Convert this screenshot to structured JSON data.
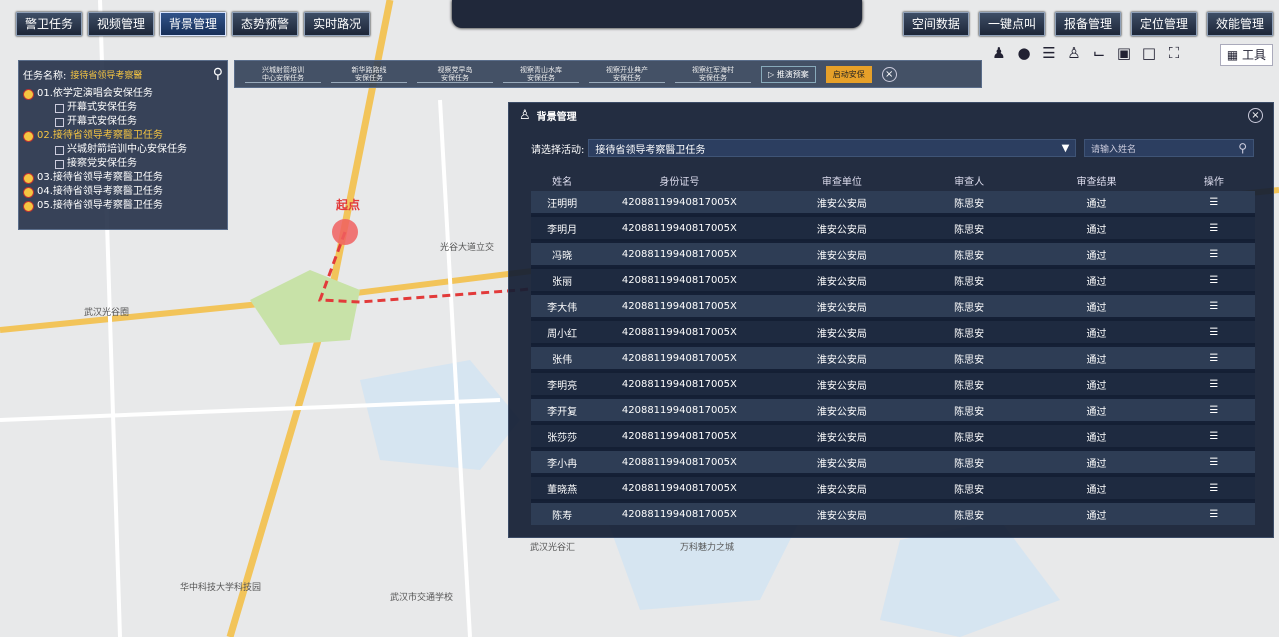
{
  "nav_left": [
    "警卫任务",
    "视频管理",
    "背景管理",
    "态势预警",
    "实时路况"
  ],
  "nav_right": [
    "空间数据",
    "一键点叫",
    "报备管理",
    "定位管理",
    "效能管理"
  ],
  "active_nav": "背景管理",
  "toolbar_label": "工具",
  "task_panel": {
    "label": "任务名称:",
    "value": "接待省领导考察醫",
    "tasks": [
      {
        "text": "01.依学定演唱会安保任务",
        "sub": [
          "开幕式安保任务",
          "开幕式安保任务"
        ]
      },
      {
        "text": "02.接待省领导考察醫卫任务",
        "selected": true,
        "sub": [
          "兴城射箭培训中心安保任务",
          "接察党安保任务"
        ]
      },
      {
        "text": "03.接待省领导考察醫卫任务",
        "sub": []
      },
      {
        "text": "04.接待省领导考察醫卫任务",
        "sub": []
      },
      {
        "text": "05.接待省领导考察醫卫任务",
        "sub": []
      }
    ]
  },
  "route_steps": [
    "兴城射箭培训\n中心安保任务",
    "新华路路线\n安保任务",
    "视察党早岛\n安保任务",
    "视察青山水库\n安保任务",
    "视察开业典产\n安保任务",
    "视察红军海村\n安保任务"
  ],
  "route_controls": {
    "preview": "推演预案",
    "start": "启动安保"
  },
  "panel": {
    "title": "背景管理",
    "filter_label": "请选择活动:",
    "filter_value": "接待省领导考察醫卫任务",
    "name_placeholder": "请输入姓名",
    "columns": [
      "姓名",
      "身份证号",
      "审查单位",
      "审查人",
      "审查结果",
      "操作"
    ],
    "rows": [
      [
        "汪明明",
        "42088119940817005X",
        "淮安公安局",
        "陈思安",
        "通过"
      ],
      [
        "李明月",
        "42088119940817005X",
        "淮安公安局",
        "陈思安",
        "通过"
      ],
      [
        "冯晓",
        "42088119940817005X",
        "淮安公安局",
        "陈思安",
        "通过"
      ],
      [
        "张丽",
        "42088119940817005X",
        "淮安公安局",
        "陈思安",
        "通过"
      ],
      [
        "李大伟",
        "42088119940817005X",
        "淮安公安局",
        "陈思安",
        "通过"
      ],
      [
        "周小红",
        "42088119940817005X",
        "淮安公安局",
        "陈思安",
        "通过"
      ],
      [
        "张伟",
        "42088119940817005X",
        "淮安公安局",
        "陈思安",
        "通过"
      ],
      [
        "李明亮",
        "42088119940817005X",
        "淮安公安局",
        "陈思安",
        "通过"
      ],
      [
        "李开复",
        "42088119940817005X",
        "淮安公安局",
        "陈思安",
        "通过"
      ],
      [
        "张莎莎",
        "42088119940817005X",
        "淮安公安局",
        "陈思安",
        "通过"
      ],
      [
        "李小冉",
        "42088119940817005X",
        "淮安公安局",
        "陈思安",
        "通过"
      ],
      [
        "董晓燕",
        "42088119940817005X",
        "淮安公安局",
        "陈思安",
        "通过"
      ],
      [
        "陈寿",
        "42088119940817005X",
        "淮安公安局",
        "陈思安",
        "通过"
      ]
    ]
  },
  "map_labels": [
    "光谷大道立交",
    "武汉光谷圈",
    "武汉市交通学校",
    "华中科技大学科技园",
    "万科魅力之城",
    "武汉光谷汇",
    "起点"
  ]
}
